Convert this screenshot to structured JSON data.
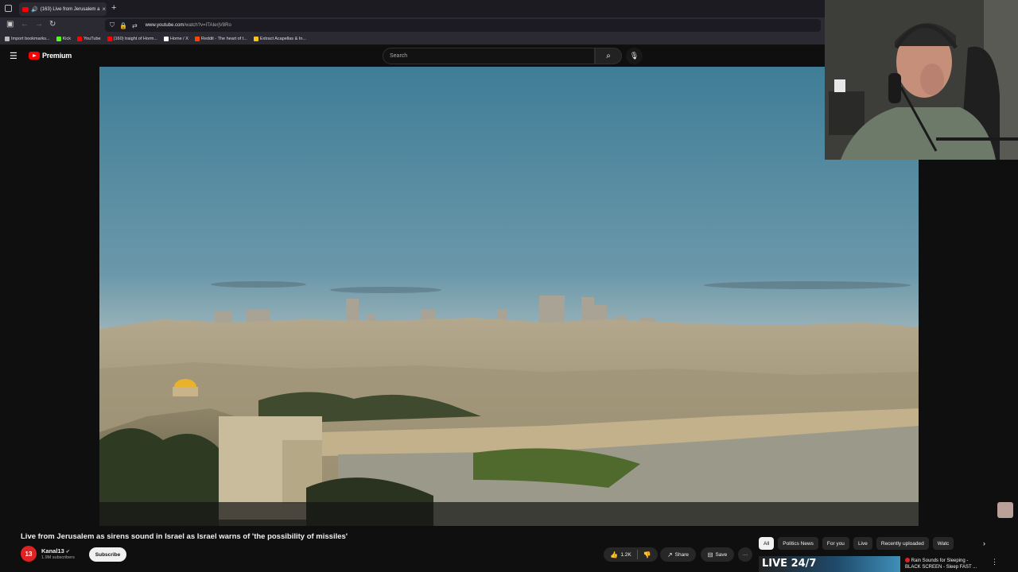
{
  "browser": {
    "tab_title": "(163) Live from Jerusalem a",
    "new_tab": "+",
    "url_host": "www.youtube.com",
    "url_path": "/watch?v=ITAIerjV8Ro",
    "bookmarks": [
      {
        "label": "Import bookmarks...",
        "color": "#bbbbbb"
      },
      {
        "label": "Kick",
        "color": "#53fc18"
      },
      {
        "label": "YouTube",
        "color": "#ff0000"
      },
      {
        "label": "(160) traight of Horm...",
        "color": "#ff0000"
      },
      {
        "label": "Home / X",
        "color": "#ffffff"
      },
      {
        "label": "Reddit - The heart of t...",
        "color": "#ff4500"
      },
      {
        "label": "Extract Acapellas & In...",
        "color": "#f5c518"
      }
    ]
  },
  "header": {
    "logo_text": "Premium",
    "search_placeholder": "Search"
  },
  "video": {
    "title": "Live from Jerusalem as sirens sound in Israel as Israel warns of 'the possibility of missiles'"
  },
  "channel": {
    "avatar_text": "13",
    "name": "Kanal13",
    "subscribers": "1.9M subscribers",
    "subscribe_label": "Subscribe"
  },
  "actions": {
    "likes": "1.2K",
    "share_label": "Share",
    "save_label": "Save",
    "more_label": "···"
  },
  "chips": [
    "All",
    "Politics News",
    "For you",
    "Live",
    "Recently uploaded",
    "Watc"
  ],
  "recommendation": {
    "thumb_text": "LIVE 24/7",
    "title_line1": "Rain Sounds for Sleeping -",
    "title_line2": "BLACK SCREEN - Sleep FAST ..."
  },
  "colors": {
    "accent": "#ff0000",
    "background": "#0f0f0f"
  }
}
